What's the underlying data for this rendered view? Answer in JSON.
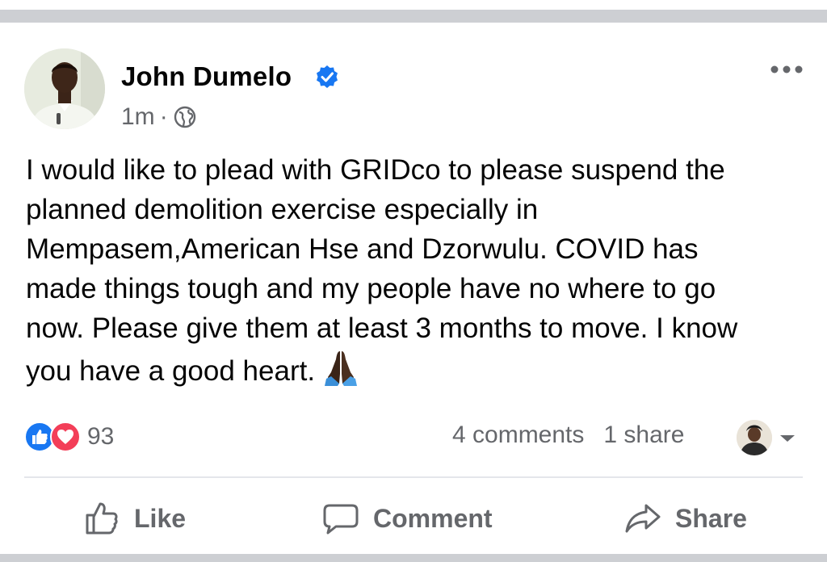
{
  "post": {
    "author": "John Dumelo",
    "time": "1m",
    "separator": "·",
    "text_lines": [
      "I would like to plead with GRIDco to please suspend the",
      "planned demolition exercise especially in",
      "Mempasem,American Hse and Dzorwulu. COVID has",
      "made things tough and my people have no where to go",
      "now. Please give them at least 3 months to move. I know",
      "you have a good heart."
    ]
  },
  "engagement": {
    "reactions_count": "93",
    "comments": "4 comments",
    "shares": "1 share"
  },
  "actions": {
    "like": "Like",
    "comment": "Comment",
    "share": "Share"
  },
  "icons": {
    "verified": "verified-badge-icon",
    "privacy": "globe-icon",
    "more": "more-options-icon",
    "emoji": "folded-hands-emoji",
    "reactions": [
      "like-reaction-icon",
      "love-reaction-icon"
    ]
  },
  "colors": {
    "brand_blue": "#1877f2",
    "love_red": "#f33e58",
    "muted_text": "#65676b",
    "separator_gray": "#cdcfd3"
  }
}
